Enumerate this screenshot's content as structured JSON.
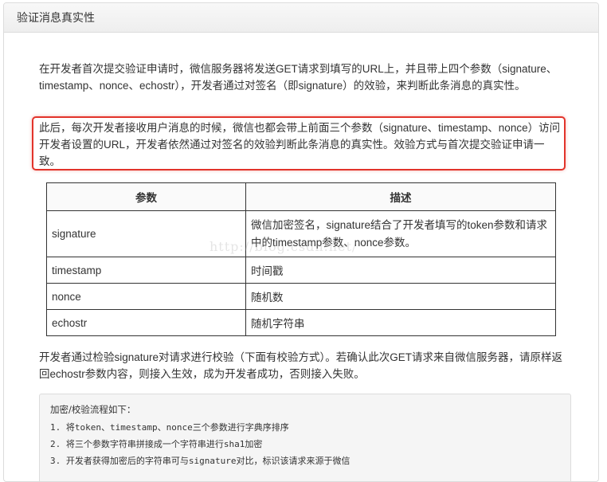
{
  "panel": {
    "title": "验证消息真实性"
  },
  "intro": "在开发者首次提交验证申请时，微信服务器将发送GET请求到填写的URL上，并且带上四个参数（signature、timestamp、nonce、echostr），开发者通过对签名（即signature）的效验，来判断此条消息的真实性。",
  "highlight": "此后，每次开发者接收用户消息的时候，微信也都会带上前面三个参数（signature、timestamp、nonce）访问开发者设置的URL，开发者依然通过对签名的效验判断此条消息的真实性。效验方式与首次提交验证申请一致。",
  "table": {
    "headers": [
      "参数",
      "描述"
    ],
    "rows": [
      {
        "param": "signature",
        "desc": "微信加密签名，signature结合了开发者填写的token参数和请求中的timestamp参数、nonce参数。"
      },
      {
        "param": "timestamp",
        "desc": "时间戳"
      },
      {
        "param": "nonce",
        "desc": "随机数"
      },
      {
        "param": "echostr",
        "desc": "随机字符串"
      }
    ]
  },
  "watermark": "http://blog.csdn.net/",
  "after_table": "开发者通过检验signature对请求进行校验（下面有校验方式）。若确认此次GET请求来自微信服务器，请原样返回echostr参数内容，则接入生效，成为开发者成功，否则接入失败。",
  "code": {
    "title": "加密/校验流程如下：",
    "lines": [
      "1. 将token、timestamp、nonce三个参数进行字典序排序",
      "2. 将三个参数字符串拼接成一个字符串进行sha1加密",
      "3. 开发者获得加密后的字符串可与signature对比，标识该请求来源于微信"
    ]
  },
  "colors": {
    "highlight_border": "#e2342b",
    "header_bg": "#eeeeee"
  }
}
